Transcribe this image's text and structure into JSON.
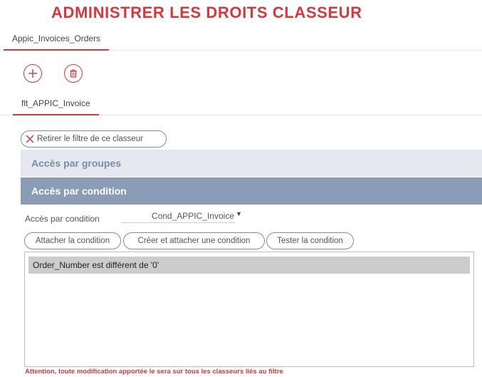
{
  "page": {
    "title": "ADMINISTRER LES DROITS CLASSEUR"
  },
  "tabs": [
    {
      "label": "Appic_Invoices_Orders",
      "active": true
    }
  ],
  "toolbar": {
    "add_icon": "plus-icon",
    "delete_icon": "trash-icon"
  },
  "filter_tabs": [
    {
      "label": "flt_APPIC_Invoice",
      "active": true
    }
  ],
  "remove_filter_label": "Retirer le filtre de ce classeur",
  "sections": {
    "groups": {
      "label": "Accès par groupes"
    },
    "condition": {
      "label": "Accès par condition"
    }
  },
  "condition_form": {
    "label": "Accès par condition",
    "selected_value": "Cond_APPIC_Invoice"
  },
  "buttons": {
    "attach": "Attacher la condition",
    "create_attach": "Créer et attacher une condition",
    "test": "Tester la condition"
  },
  "condition_list": [
    "Order_Number est différent de '0'"
  ],
  "warning": "Attention, toute modification apportée le sera sur tous les classeurs liés au filtre",
  "colors": {
    "accent": "#d9373b",
    "section_light": "#e6e8f0",
    "section_dark": "#8b9cb6"
  }
}
